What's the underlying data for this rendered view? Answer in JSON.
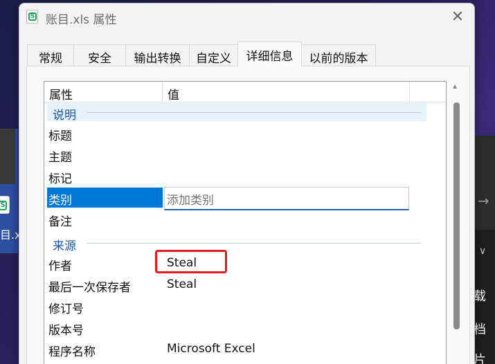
{
  "background": {
    "file_label": "目.x",
    "right_chars": [
      "载",
      "档",
      "片"
    ]
  },
  "dialog": {
    "title": "账目.xls 属性",
    "tabs": [
      "常规",
      "安全",
      "输出转换",
      "自定义",
      "详细信息",
      "以前的版本"
    ],
    "active_tab": "详细信息",
    "columns": {
      "property": "属性",
      "value": "值"
    },
    "groups": {
      "description": "说明",
      "origin": "来源"
    },
    "rows": [
      {
        "name": "标题",
        "value": ""
      },
      {
        "name": "主题",
        "value": ""
      },
      {
        "name": "标记",
        "value": ""
      },
      {
        "name": "类别",
        "value": ""
      },
      {
        "name": "备注",
        "value": ""
      },
      {
        "name": "作者",
        "value": "Steal"
      },
      {
        "name": "最后一次保存者",
        "value": "Steal"
      },
      {
        "name": "修订号",
        "value": ""
      },
      {
        "name": "版本号",
        "value": ""
      },
      {
        "name": "程序名称",
        "value": "Microsoft Excel"
      }
    ],
    "category_edit": {
      "placeholder": "添加类别",
      "value": ""
    }
  },
  "colors": {
    "accent": "#0078d7",
    "group_text": "#1a56a8",
    "highlight": "#e31b1b"
  }
}
